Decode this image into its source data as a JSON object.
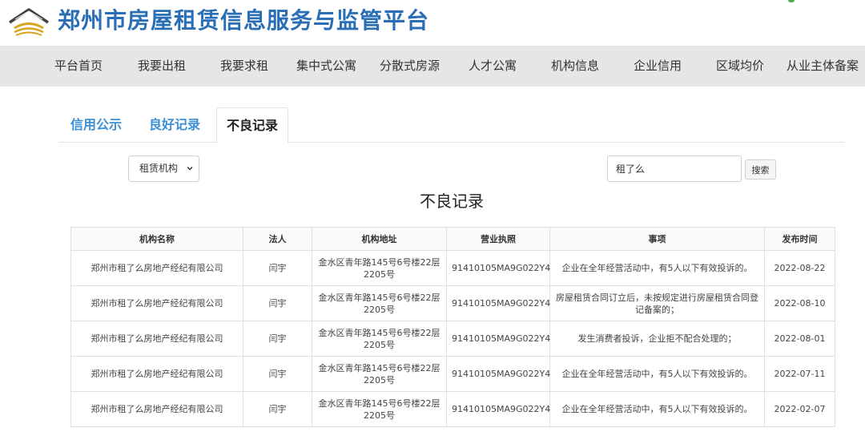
{
  "header": {
    "site_title": "郑州市房屋租赁信息服务与监管平台"
  },
  "nav": {
    "items": [
      "平台首页",
      "我要出租",
      "我要求租",
      "集中式公寓",
      "分散式房源",
      "人才公寓",
      "机构信息",
      "企业信用",
      "区域均价",
      "从业主体备案"
    ]
  },
  "tabs": [
    "信用公示",
    "良好记录",
    "不良记录"
  ],
  "filter": {
    "select_value": "租赁机构",
    "search_value": "租了么",
    "search_button": "搜索"
  },
  "section_title": "不良记录",
  "table": {
    "columns": [
      "机构名称",
      "法人",
      "机构地址",
      "营业执照",
      "事项",
      "发布时间"
    ],
    "rows": [
      [
        "郑州市租了么房地产经纪有限公司",
        "闫宇",
        "金水区青年路145号6号楼22层2205号",
        "91410105MA9G022Y4",
        "企业在全年经营活动中，有5人以下有效投诉的。",
        "2022-08-22"
      ],
      [
        "郑州市租了么房地产经纪有限公司",
        "闫宇",
        "金水区青年路145号6号楼22层2205号",
        "91410105MA9G022Y4",
        "房屋租赁合同订立后，未按规定进行房屋租赁合同登记备案的；",
        "2022-08-10"
      ],
      [
        "郑州市租了么房地产经纪有限公司",
        "闫宇",
        "金水区青年路145号6号楼22层2205号",
        "91410105MA9G022Y4",
        "发生消费者投诉，企业拒不配合处理的；",
        "2022-08-01"
      ],
      [
        "郑州市租了么房地产经纪有限公司",
        "闫宇",
        "金水区青年路145号6号楼22层2205号",
        "91410105MA9G022Y4",
        "企业在全年经营活动中，有5人以下有效投诉的。",
        "2022-07-11"
      ],
      [
        "郑州市租了么房地产经纪有限公司",
        "闫宇",
        "金水区青年路145号6号楼22层2205号",
        "91410105MA9G022Y4",
        "企业在全年经营活动中，有5人以下有效投诉的。",
        "2022-02-07"
      ]
    ]
  },
  "colors": {
    "title_blue": "#2a6fb5",
    "tab_blue": "#3a8fd6",
    "nav_bg": "#e6e6e6",
    "logo_gold": "#d9a520"
  }
}
